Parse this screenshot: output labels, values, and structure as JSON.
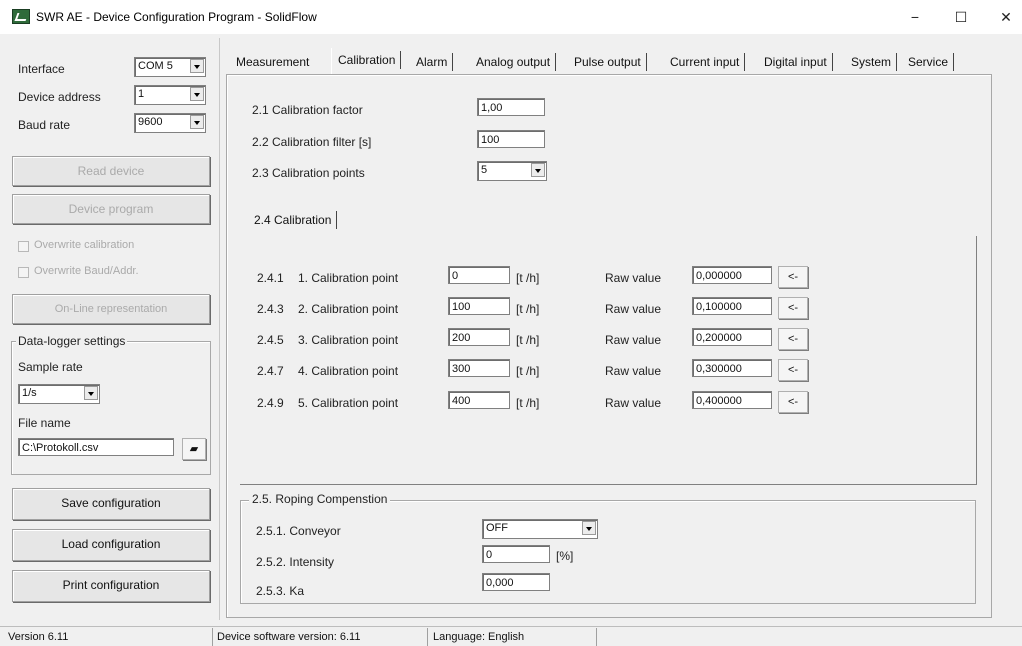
{
  "window": {
    "title": "SWR AE - Device Configuration Program - SolidFlow",
    "minimize": "−",
    "maximize": "☐",
    "close": "✕"
  },
  "left": {
    "interface_label": "Interface",
    "interface_value": "COM 5",
    "address_label": "Device address",
    "address_value": "1",
    "baud_label": "Baud rate",
    "baud_value": "9600",
    "read_device": "Read device",
    "device_program": "Device program",
    "overwrite_calibration": "Overwrite calibration",
    "overwrite_baud": "Overwrite Baud/Addr.",
    "online": "On-Line representation",
    "datalogger_title": "Data-logger settings",
    "sample_rate_label": "Sample rate",
    "sample_rate_value": "1/s",
    "file_name_label": "File name",
    "file_name_value": "C:\\Protokoll.csv",
    "save": "Save configuration",
    "load": "Load configuration",
    "print": "Print configuration"
  },
  "tabs": [
    "Measurement",
    "Calibration",
    "Alarm",
    "Analog output",
    "Pulse output",
    "Current input",
    "Digital input",
    "System",
    "Service"
  ],
  "calibration": {
    "factor_label": "2.1 Calibration factor",
    "factor_value": "1,00",
    "filter_label": "2.2 Calibration filter [s]",
    "filter_value": "100",
    "points_label": "2.3 Calibration points",
    "points_value": "5",
    "subtab": "2.4 Calibration",
    "rows": [
      {
        "num": "2.4.1",
        "label": "1. Calibration point",
        "value": "0",
        "unit": "[t /h]",
        "raw_label": "Raw value",
        "raw": "0,000000",
        "btn": "<-"
      },
      {
        "num": "2.4.3",
        "label": "2. Calibration point",
        "value": "100",
        "unit": "[t /h]",
        "raw_label": "Raw value",
        "raw": "0,100000",
        "btn": "<-"
      },
      {
        "num": "2.4.5",
        "label": "3. Calibration point",
        "value": "200",
        "unit": "[t /h]",
        "raw_label": "Raw value",
        "raw": "0,200000",
        "btn": "<-"
      },
      {
        "num": "2.4.7",
        "label": "4. Calibration point",
        "value": "300",
        "unit": "[t /h]",
        "raw_label": "Raw value",
        "raw": "0,300000",
        "btn": "<-"
      },
      {
        "num": "2.4.9",
        "label": "5. Calibration point",
        "value": "400",
        "unit": "[t /h]",
        "raw_label": "Raw value",
        "raw": "0,400000",
        "btn": "<-"
      }
    ],
    "roping_title": "2.5. Roping Compenstion",
    "conveyor_label": "2.5.1. Conveyor",
    "conveyor_value": "OFF",
    "intensity_label": "2.5.2. Intensity",
    "intensity_value": "0",
    "intensity_unit": "[%]",
    "ka_label": "2.5.3. Ka",
    "ka_value": "0,000"
  },
  "status": {
    "version": "Version 6.11",
    "device_sw": "Device software version: 6.11",
    "language": "Language: English"
  }
}
